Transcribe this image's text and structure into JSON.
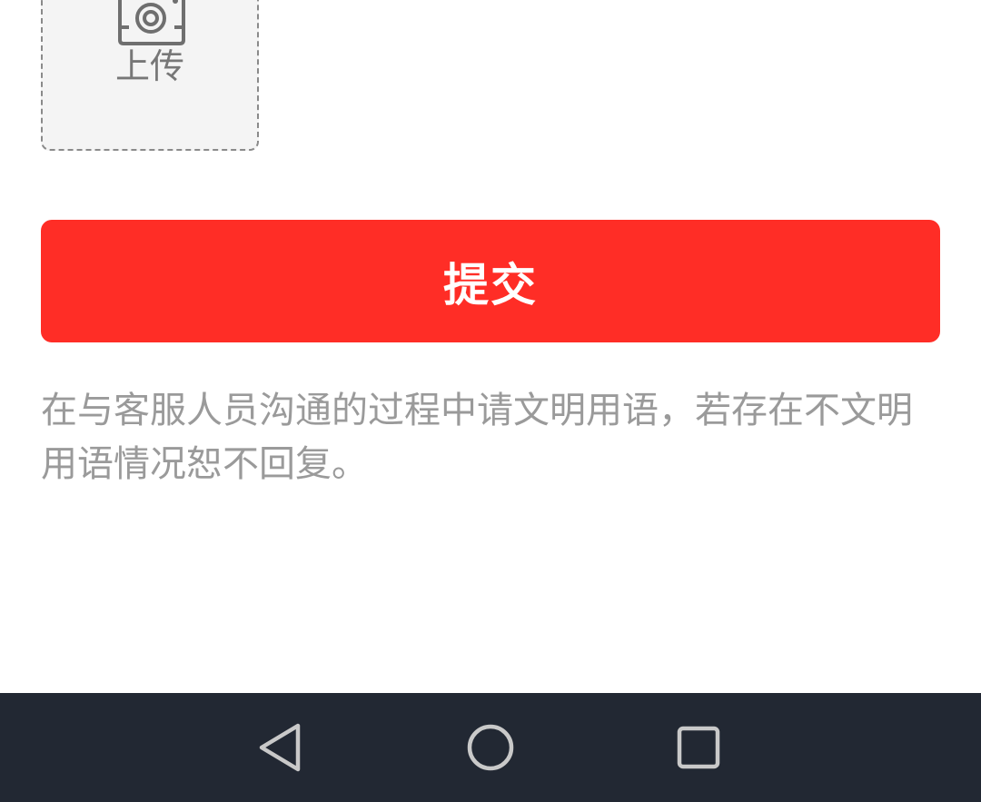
{
  "upload": {
    "label": "上传",
    "icon": "camera-icon"
  },
  "submit": {
    "label": "提交",
    "color": "#ff2d26"
  },
  "notice": {
    "text": "在与客服人员沟通的过程中请文明用语，若存在不文明用语情况恕不回复。"
  },
  "navbar": {
    "back_icon": "back-triangle-icon",
    "home_icon": "home-circle-icon",
    "recent_icon": "recent-square-icon",
    "background": "#222833"
  }
}
